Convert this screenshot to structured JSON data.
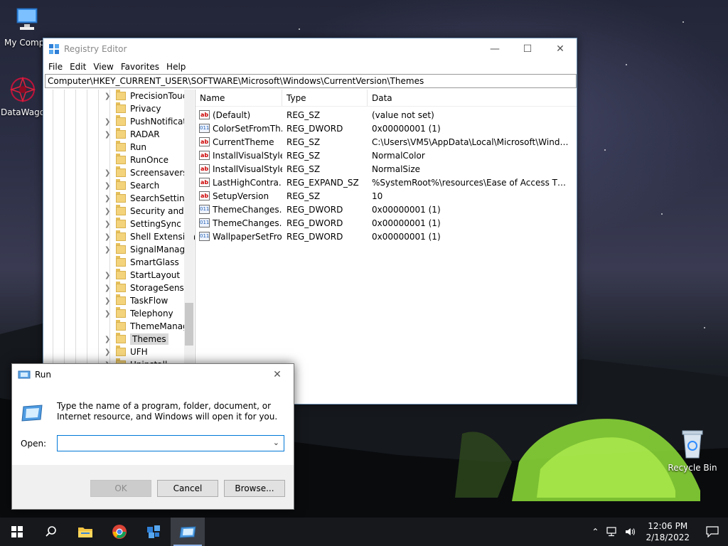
{
  "desktop": {
    "icons": [
      {
        "label": "My Compu",
        "icon": "computer-icon"
      },
      {
        "label": "DataWago",
        "icon": "datawagon-icon"
      },
      {
        "label": "Recycle Bin",
        "icon": "recycle-bin-icon"
      }
    ]
  },
  "regedit": {
    "title": "Registry Editor",
    "menu": [
      "File",
      "Edit",
      "View",
      "Favorites",
      "Help"
    ],
    "address": "Computer\\HKEY_CURRENT_USER\\SOFTWARE\\Microsoft\\Windows\\CurrentVersion\\Themes",
    "tree": [
      {
        "label": "PrecisionToucl",
        "expandable": true
      },
      {
        "label": "Privacy",
        "expandable": false
      },
      {
        "label": "PushNotificati",
        "expandable": true
      },
      {
        "label": "RADAR",
        "expandable": true
      },
      {
        "label": "Run",
        "expandable": false
      },
      {
        "label": "RunOnce",
        "expandable": false
      },
      {
        "label": "Screensavers",
        "expandable": true
      },
      {
        "label": "Search",
        "expandable": true
      },
      {
        "label": "SearchSettings",
        "expandable": true
      },
      {
        "label": "Security and M",
        "expandable": true
      },
      {
        "label": "SettingSync",
        "expandable": true
      },
      {
        "label": "Shell Extension",
        "expandable": true
      },
      {
        "label": "SignalManage",
        "expandable": true
      },
      {
        "label": "SmartGlass",
        "expandable": false
      },
      {
        "label": "StartLayout",
        "expandable": true
      },
      {
        "label": "StorageSense",
        "expandable": true
      },
      {
        "label": "TaskFlow",
        "expandable": true
      },
      {
        "label": "Telephony",
        "expandable": true
      },
      {
        "label": "ThemeManage",
        "expandable": false
      },
      {
        "label": "Themes",
        "expandable": true,
        "selected": true
      },
      {
        "label": "UFH",
        "expandable": true
      },
      {
        "label": "Uninstall",
        "expandable": true
      }
    ],
    "columns": [
      "Name",
      "Type",
      "Data"
    ],
    "values": [
      {
        "icon": "ab",
        "name": "(Default)",
        "type": "REG_SZ",
        "data": "(value not set)"
      },
      {
        "icon": "bin",
        "name": "ColorSetFromTh...",
        "type": "REG_DWORD",
        "data": "0x00000001 (1)"
      },
      {
        "icon": "ab",
        "name": "CurrentTheme",
        "type": "REG_SZ",
        "data": "C:\\Users\\VM5\\AppData\\Local\\Microsoft\\Windows..."
      },
      {
        "icon": "ab",
        "name": "InstallVisualStyle...",
        "type": "REG_SZ",
        "data": "NormalColor"
      },
      {
        "icon": "ab",
        "name": "InstallVisualStyle...",
        "type": "REG_SZ",
        "data": "NormalSize"
      },
      {
        "icon": "ab",
        "name": "LastHighContra...",
        "type": "REG_EXPAND_SZ",
        "data": "%SystemRoot%\\resources\\Ease of Access Themes..."
      },
      {
        "icon": "ab",
        "name": "SetupVersion",
        "type": "REG_SZ",
        "data": "10"
      },
      {
        "icon": "bin",
        "name": "ThemeChanges...",
        "type": "REG_DWORD",
        "data": "0x00000001 (1)"
      },
      {
        "icon": "bin",
        "name": "ThemeChanges...",
        "type": "REG_DWORD",
        "data": "0x00000001 (1)"
      },
      {
        "icon": "bin",
        "name": "WallpaperSetFro...",
        "type": "REG_DWORD",
        "data": "0x00000001 (1)"
      }
    ]
  },
  "run": {
    "title": "Run",
    "description": "Type the name of a program, folder, document, or Internet resource, and Windows will open it for you.",
    "open_label": "Open:",
    "open_value": "",
    "ok_label": "OK",
    "cancel_label": "Cancel",
    "browse_label": "Browse..."
  },
  "taskbar": {
    "time": "12:06 PM",
    "date": "2/18/2022"
  }
}
